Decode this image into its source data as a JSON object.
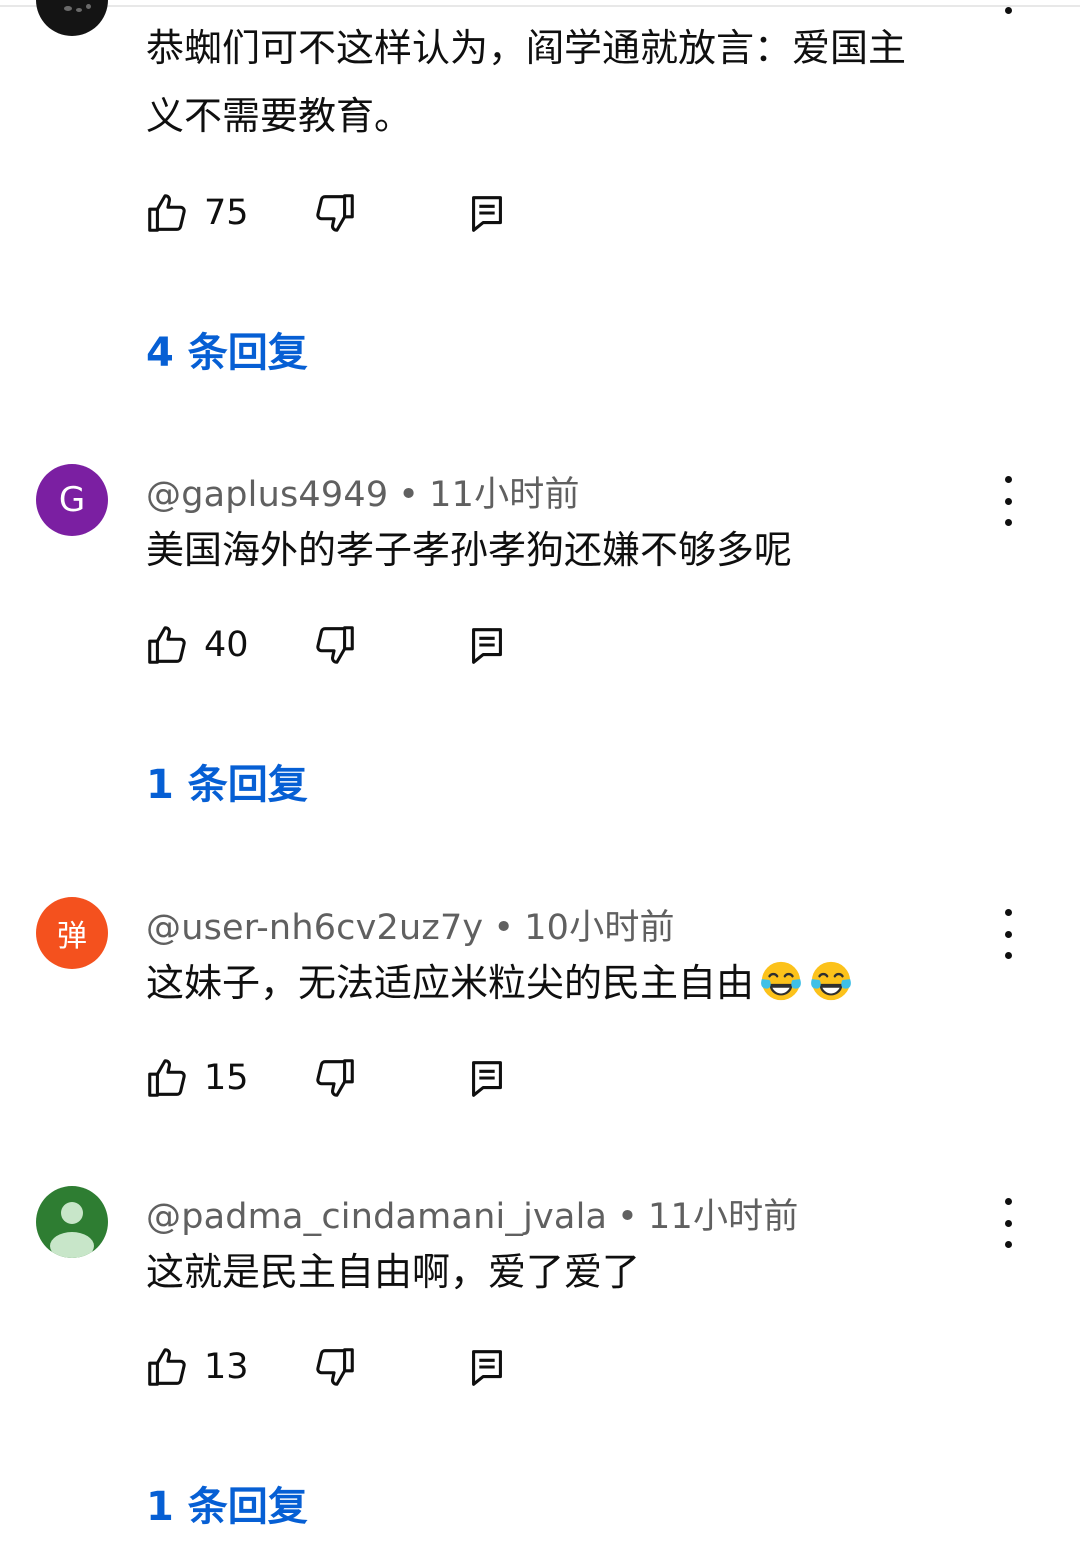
{
  "comments": [
    {
      "id": "c0",
      "partial": true,
      "text_lines": [
        "恭蜘们可不这样认为，阎学通就放言：爱国主",
        "义不需要教育。"
      ],
      "likes": "75",
      "replies_label": "4 条回复"
    },
    {
      "id": "c1",
      "avatar_letter": "G",
      "avatar_color": "#7b1fa2",
      "author": "@gaplus4949",
      "separator": "•",
      "time": "11小时前",
      "text": "美国海外的孝子孝孙孝狗还嫌不够多呢",
      "likes": "40",
      "replies_label": "1 条回复"
    },
    {
      "id": "c2",
      "avatar_letter": "弹",
      "avatar_color": "#f4511e",
      "author": "@user-nh6cv2uz7y",
      "separator": "•",
      "time": "10小时前",
      "text": "这妹子，无法适应米粒尖的民主自由",
      "text_emojis": [
        "face-with-tears-of-joy",
        "face-with-tears-of-joy"
      ],
      "likes": "15"
    },
    {
      "id": "c3",
      "avatar_color": "#2e7d32",
      "avatar_icon": "default-person-icon",
      "author": "@padma_cindamani_jvala",
      "separator": "•",
      "time": "11小时前",
      "text": "这就是民主自由啊，爱了爱了",
      "likes": "13",
      "replies_label": "1 条回复"
    }
  ],
  "icons": {
    "like": "thumbs-up-icon",
    "dislike": "thumbs-down-icon",
    "reply": "reply-comment-icon",
    "more": "more-vertical-icon"
  },
  "colors": {
    "link": "#065fd4",
    "meta": "#606060",
    "text": "#0f0f0f"
  }
}
